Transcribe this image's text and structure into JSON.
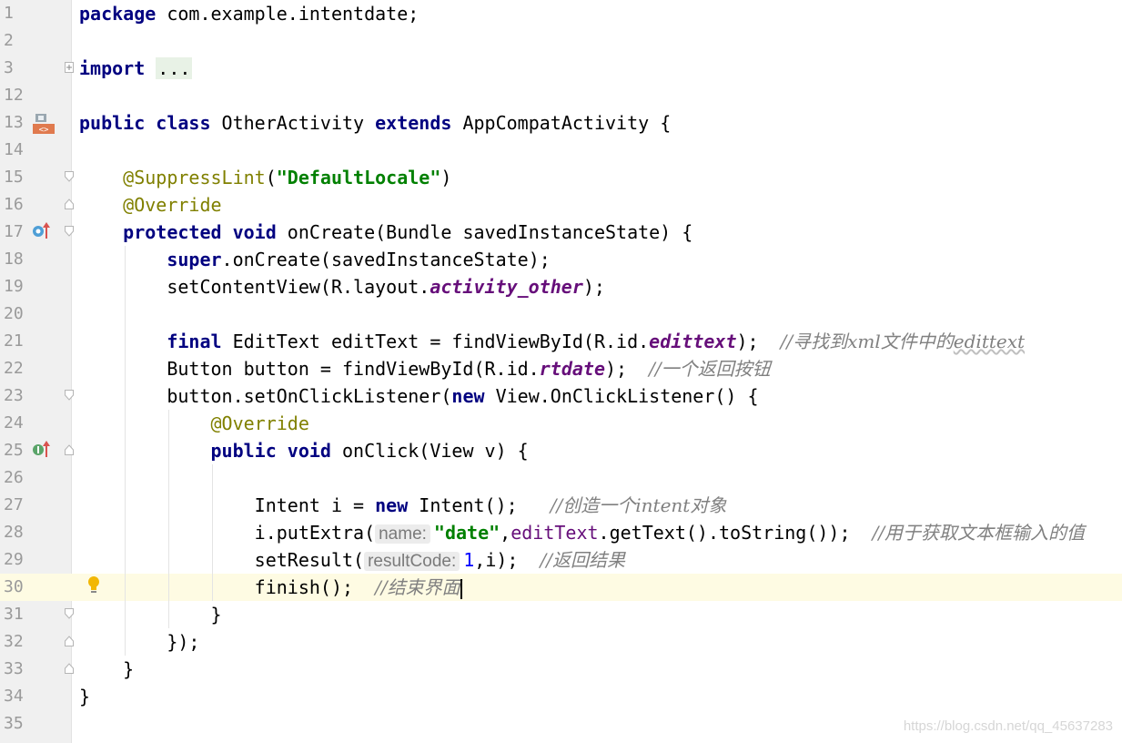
{
  "editor": {
    "lines": [
      {
        "num": "1",
        "code": "<span class=\"kw\">package</span> com.example.intentdate;"
      },
      {
        "num": "2",
        "code": ""
      },
      {
        "num": "3",
        "code": "<span class=\"kw\">import</span> <span class=\"fold-txt\">...</span>"
      },
      {
        "num": "12",
        "code": ""
      },
      {
        "num": "13",
        "code": "<span class=\"kw\">public class</span> OtherActivity <span class=\"kw\">extends</span> AppCompatActivity {"
      },
      {
        "num": "14",
        "code": ""
      },
      {
        "num": "15",
        "code": "    <span class=\"ann\">@SuppressLint</span>(<span class=\"str\">\"DefaultLocale\"</span>)"
      },
      {
        "num": "16",
        "code": "    <span class=\"ann\">@Override</span>"
      },
      {
        "num": "17",
        "code": "    <span class=\"kw\">protected void</span> onCreate(Bundle savedInstanceState) {"
      },
      {
        "num": "18",
        "code": "        <span class=\"kw\">super</span>.onCreate(savedInstanceState);"
      },
      {
        "num": "19",
        "code": "        setContentView(R.layout.<span class=\"fld\">activity_other</span>);"
      },
      {
        "num": "20",
        "code": ""
      },
      {
        "num": "21",
        "code": "        <span class=\"kw\">final</span> EditText editText = findViewById(R.id.<span class=\"fld\">edittext</span>);  <span class=\"cmt\">//寻找到xml文件中的<span class=\"squiggle\">edittext</span></span>"
      },
      {
        "num": "22",
        "code": "        Button button = findViewById(R.id.<span class=\"fld\">rtdate</span>);  <span class=\"cmt\">//一个返回按钮</span>"
      },
      {
        "num": "23",
        "code": "        button.setOnClickListener(<span class=\"kw\">new</span> View.OnClickListener() {"
      },
      {
        "num": "24",
        "code": "            <span class=\"ann\">@Override</span>"
      },
      {
        "num": "25",
        "code": "            <span class=\"kw\">public void</span> onClick(View v) {"
      },
      {
        "num": "26",
        "code": ""
      },
      {
        "num": "27",
        "code": "                Intent i = <span class=\"kw\">new</span> Intent();   <span class=\"cmt\">//创造一个intent对象</span>"
      },
      {
        "num": "28",
        "code": "                i.putExtra(<span class=\"hint\">name:</span><span class=\"str\">\"date\"</span>,<span class=\"mem\">editText</span>.getText().toString());  <span class=\"cmt\">//用于获取文本框输入的值</span>"
      },
      {
        "num": "29",
        "code": "                setResult(<span class=\"hint\">resultCode:</span><span class=\"num\">1</span>,i);  <span class=\"cmt\">//返回结果</span>"
      },
      {
        "num": "30",
        "code": "                finish();  <span class=\"cmt\">//结束界面</span><span class=\"caret-bar\"></span>"
      },
      {
        "num": "31",
        "code": "            }"
      },
      {
        "num": "32",
        "code": "        });"
      },
      {
        "num": "33",
        "code": "    }"
      },
      {
        "num": "34",
        "code": "}"
      },
      {
        "num": "35",
        "code": ""
      }
    ],
    "caret_line": "30"
  },
  "gutter_icons": {
    "class_icon": "class-implementation-icon",
    "override_icon": "overrides-method-icon",
    "implements_icon": "implements-method-icon",
    "intention_icon": "lightbulb-icon"
  },
  "watermark": "https://blog.csdn.net/qq_45637283"
}
